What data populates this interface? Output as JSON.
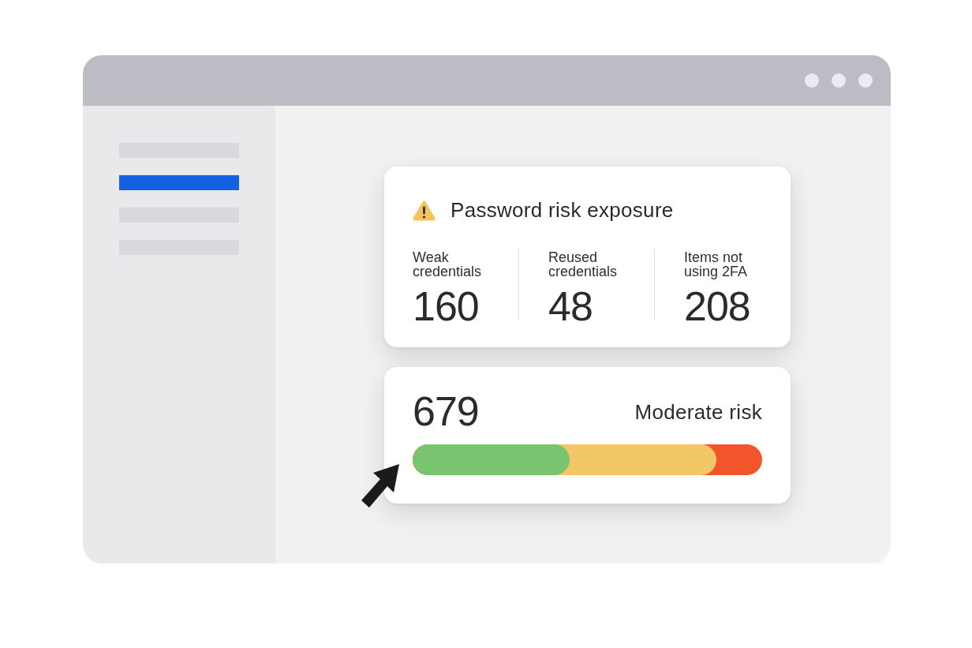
{
  "sidebar": {
    "items": [
      {
        "selected": false
      },
      {
        "selected": true
      },
      {
        "selected": false
      },
      {
        "selected": false
      }
    ]
  },
  "exposure_card": {
    "title": "Password risk exposure",
    "stats": [
      {
        "label": "Weak credentials",
        "value": "160"
      },
      {
        "label": "Reused credentials",
        "value": "48"
      },
      {
        "label": "Items not using 2FA",
        "value": "208"
      }
    ]
  },
  "score_card": {
    "score": "679",
    "rating": "Moderate risk",
    "segments": [
      {
        "color": "#78c46f",
        "level": 0.45
      },
      {
        "color": "#f4c766",
        "level": 0.87
      }
    ]
  }
}
